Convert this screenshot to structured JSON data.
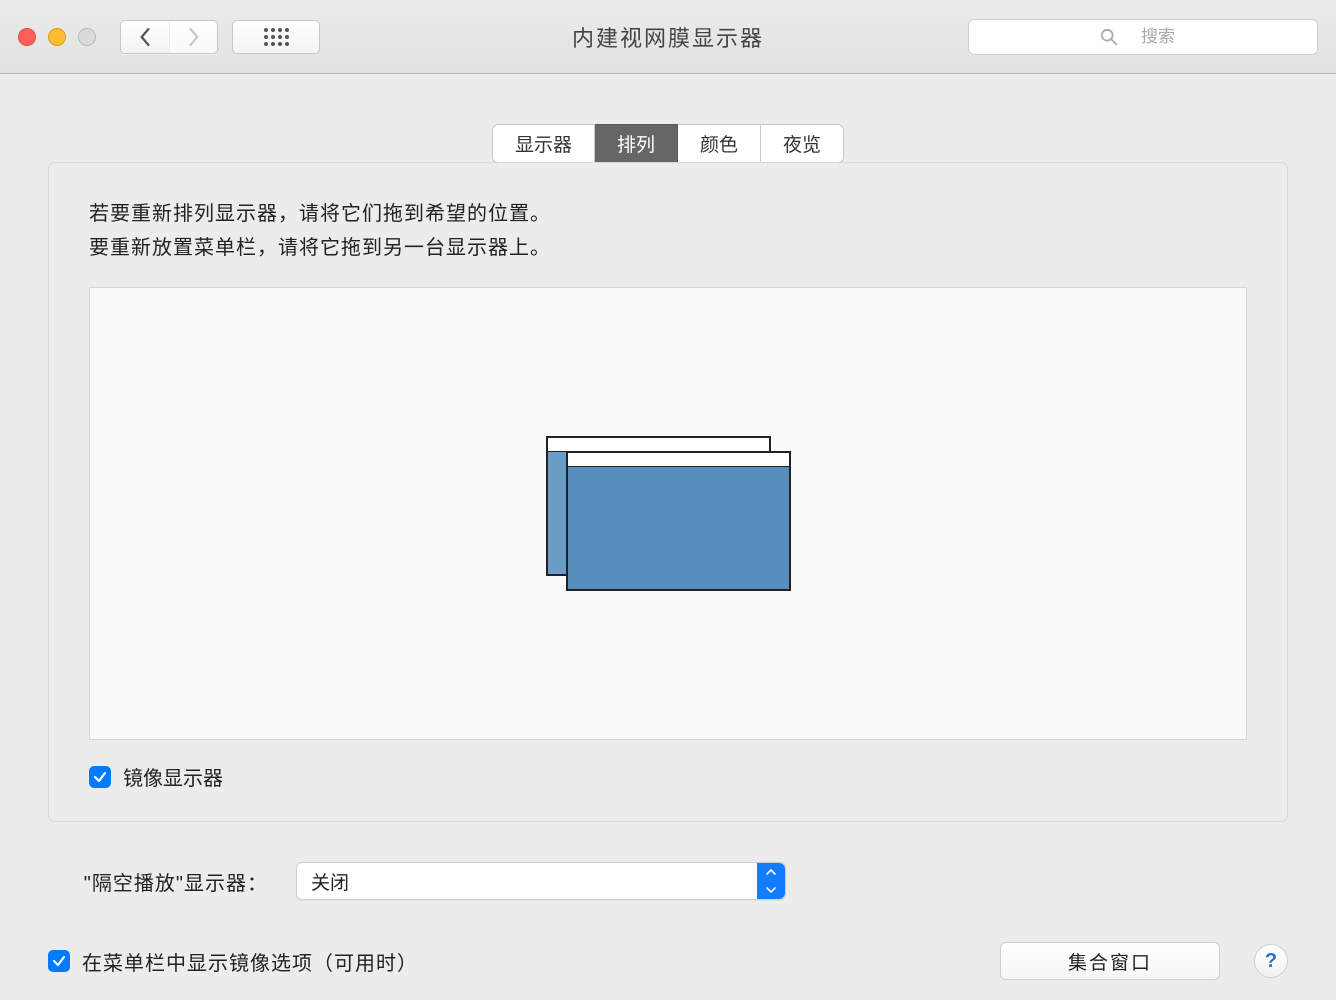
{
  "window": {
    "title": "内建视网膜显示器"
  },
  "search": {
    "placeholder": "搜索"
  },
  "tabs": [
    {
      "label": "显示器",
      "active": false
    },
    {
      "label": "排列",
      "active": true
    },
    {
      "label": "颜色",
      "active": false
    },
    {
      "label": "夜览",
      "active": false
    }
  ],
  "instructions": {
    "line1": "若要重新排列显示器，请将它们拖到希望的位置。",
    "line2": "要重新放置菜单栏，请将它拖到另一台显示器上。"
  },
  "mirror": {
    "label": "镜像显示器",
    "checked": true
  },
  "airplay": {
    "label": "\"隔空播放\"显示器：",
    "value": "关闭"
  },
  "menubar_option": {
    "label": "在菜单栏中显示镜像选项（可用时）",
    "checked": true
  },
  "gather": {
    "label": "集合窗口"
  },
  "help": {
    "label": "?"
  },
  "colors": {
    "accent": "#007aff",
    "display_blue": "#578ebd"
  }
}
